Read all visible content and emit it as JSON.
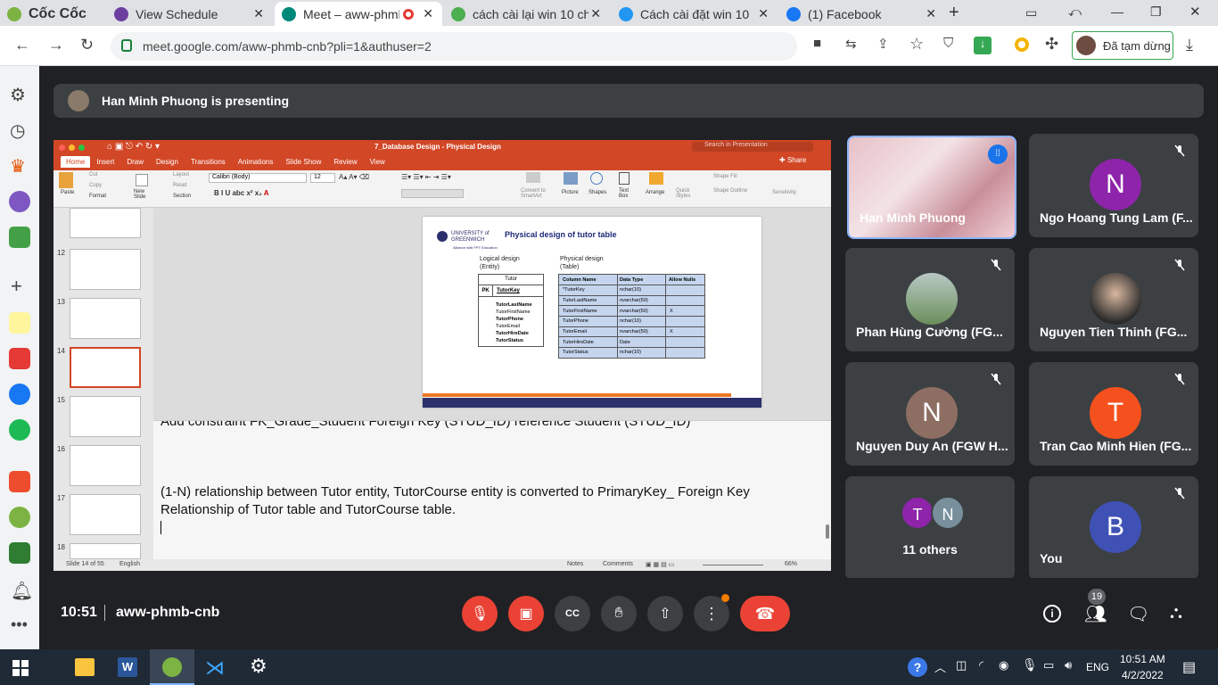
{
  "browser": {
    "brand": "Cốc Cốc",
    "tabs": [
      {
        "title": "View Schedule",
        "color": "#6b3fa0"
      },
      {
        "title": "Meet – aww-phmb",
        "color": "#00897b"
      },
      {
        "title": "cách cài lại win 10 ch",
        "color": "#4caf50"
      },
      {
        "title": "Cách cài đặt win 10",
        "color": "#2196f3"
      },
      {
        "title": "(1) Facebook",
        "color": "#1877f2"
      }
    ],
    "url": "meet.google.com/aww-phmb-cnb?pli=1&authuser=2",
    "profile_label": "Đã tạm dừng"
  },
  "meet": {
    "presenting_text": "Han Minh Phuong is presenting",
    "time": "10:51",
    "meeting_code": "aww-phmb-cnb",
    "participants_badge": "19",
    "tiles": [
      {
        "name": "Han Minh Phuong",
        "initial": "",
        "color": "#c9a0a8",
        "active": true
      },
      {
        "name": "Ngo Hoang Tung Lam (F...",
        "initial": "N",
        "color": "#8e24aa"
      },
      {
        "name": "Phan Hùng Cường (FG...",
        "initial": "",
        "color": "#6b8e5a"
      },
      {
        "name": "Nguyen Tien Thinh (FG...",
        "initial": "",
        "color": "#2c2c2c"
      },
      {
        "name": "Nguyen Duy An (FGW H...",
        "initial": "N",
        "color": "#8d6e63"
      },
      {
        "name": "Tran Cao Minh Hien (FG...",
        "initial": "T",
        "color": "#f4511e"
      },
      {
        "name": "11 others",
        "initial": "",
        "color": "#3c4043"
      },
      {
        "name": "You",
        "initial": "B",
        "color": "#3f51b5"
      }
    ],
    "others_avatars": [
      {
        "initial": "T",
        "color": "#8e24aa"
      },
      {
        "initial": "N",
        "color": "#78909c"
      }
    ]
  },
  "ppt": {
    "doc_title": "7_Database Design - Physical Design",
    "search_placeholder": "Search in Presentation",
    "share_label": "Share",
    "menu": [
      "Home",
      "Insert",
      "Draw",
      "Design",
      "Transitions",
      "Animations",
      "Slide Show",
      "Review",
      "View"
    ],
    "font_name": "Calibri (Body)",
    "font_size": "12",
    "ribbon_labels": {
      "paste": "Paste",
      "cut": "Cut",
      "copy": "Copy",
      "format": "Format",
      "new_slide": "New Slide",
      "layout": "Layout",
      "reset": "Reset",
      "section": "Section",
      "picture": "Picture",
      "shapes": "Shapes",
      "text_box": "Text Box",
      "arrange": "Arrange",
      "quick_styles": "Quick Styles",
      "shape_fill": "Shape Fill",
      "shape_outline": "Shape Outline",
      "sensitivity": "Sensitivity",
      "convert": "Convert to SmartArt"
    },
    "thumb_numbers": [
      "12",
      "13",
      "14",
      "15",
      "16",
      "17",
      "18"
    ],
    "slide": {
      "university": "UNIVERSITY of GREENWICH",
      "partner": "Alliance with FPT Education",
      "title": "Physical design of tutor table",
      "logical_label": "Logical design",
      "logical_sub": "(Entity)",
      "physical_label": "Physical design",
      "physical_sub": "(Table)",
      "entity_name": "Tutor",
      "pk_label": "PK",
      "pk_field": "TutorKey",
      "entity_fields": [
        "TutorLastName",
        "TutorFirstName",
        "TutorPhone",
        "TutorEmail",
        "TutorHireDate",
        "TutorStatus"
      ],
      "table_headers": [
        "Column Name",
        "Data Type",
        "Allow Nulls"
      ],
      "table_rows": [
        [
          "*TutorKey",
          "nchar(10)",
          ""
        ],
        [
          "TutorLastName",
          "nvarchar(50)",
          ""
        ],
        [
          "TutorFirstName",
          "nvarchar(50)",
          "X"
        ],
        [
          "TutorPhone",
          "nchar(10)",
          ""
        ],
        [
          "TutorEmail",
          "nvarchar(50)",
          "X"
        ],
        [
          "TutorHireDate",
          "Date",
          ""
        ],
        [
          "TutorStatus",
          "nchar(10)",
          ""
        ]
      ]
    },
    "notes_cut_line": "Add constraint FK_Grade_Student Foreign Key (STUD_ID) reference Student (STUD_ID)",
    "notes_text": "(1-N)  relationship between Tutor entity, TutorCourse entity  is converted to PrimaryKey_ Foreign Key Relationship of Tutor table and TutorCourse table.",
    "status_slide": "Slide 14 of 55",
    "status_lang": "English",
    "status_notes": "Notes",
    "status_comments": "Comments",
    "zoom": "66%"
  },
  "taskbar": {
    "lang": "ENG",
    "time": "10:51 AM",
    "date": "4/2/2022"
  }
}
